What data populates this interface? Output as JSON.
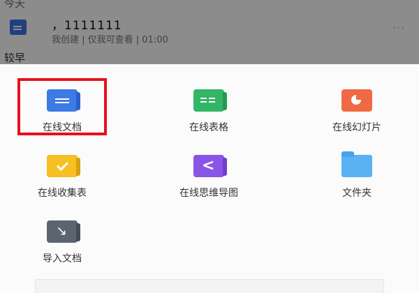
{
  "background_list": {
    "section_today": "今天",
    "document": {
      "title": "，1111111",
      "meta": "我创建 | 仅我可查看 | 01:00",
      "more": "···"
    },
    "section_earlier": "较早"
  },
  "create_menu": {
    "items": [
      {
        "label": "在线文档",
        "icon": "online-doc-icon",
        "color": "#3d7ae6",
        "highlighted": true
      },
      {
        "label": "在线表格",
        "icon": "online-sheet-icon",
        "color": "#33b566"
      },
      {
        "label": "在线幻灯片",
        "icon": "online-slides-icon",
        "color": "#ef6a43"
      },
      {
        "label": "在线收集表",
        "icon": "online-form-icon",
        "color": "#f6c024"
      },
      {
        "label": "在线思维导图",
        "icon": "mind-map-icon",
        "color": "#8a55e6"
      },
      {
        "label": "文件夹",
        "icon": "folder-icon",
        "color": "#5ab2f5"
      },
      {
        "label": "导入文档",
        "icon": "import-doc-icon",
        "color": "#5d6471"
      }
    ]
  },
  "colors": {
    "highlight_border": "#e8101b",
    "sheet_bg": "#fbfbfb",
    "overlay": "rgba(0,0,0,0.45)"
  }
}
